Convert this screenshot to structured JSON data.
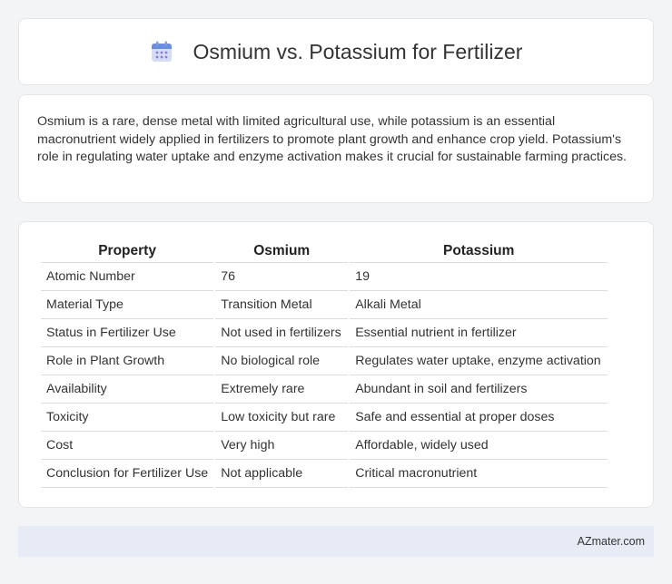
{
  "header": {
    "title": "Osmium vs. Potassium for Fertilizer",
    "icon": "calendar-icon",
    "icon_colors": {
      "top": "#6a8ee0",
      "body": "#d6dcf6",
      "dots": "#8a7fd6"
    }
  },
  "intro": {
    "text": "Osmium is a rare, dense metal with limited agricultural use, while potassium is an essential macronutrient widely applied in fertilizers to promote plant growth and enhance crop yield. Potassium's role in regulating water uptake and enzyme activation makes it crucial for sustainable farming practices."
  },
  "table": {
    "headers": [
      "Property",
      "Osmium",
      "Potassium"
    ],
    "rows": [
      [
        "Atomic Number",
        "76",
        "19"
      ],
      [
        "Material Type",
        "Transition Metal",
        "Alkali Metal"
      ],
      [
        "Status in Fertilizer Use",
        "Not used in fertilizers",
        "Essential nutrient in fertilizer"
      ],
      [
        "Role in Plant Growth",
        "No biological role",
        "Regulates water uptake, enzyme activation"
      ],
      [
        "Availability",
        "Extremely rare",
        "Abundant in soil and fertilizers"
      ],
      [
        "Toxicity",
        "Low toxicity but rare",
        "Safe and essential at proper doses"
      ],
      [
        "Cost",
        "Very high",
        "Affordable, widely used"
      ],
      [
        "Conclusion for Fertilizer Use",
        "Not applicable",
        "Critical macronutrient"
      ]
    ]
  },
  "footer": {
    "text": "AZmater.com"
  }
}
